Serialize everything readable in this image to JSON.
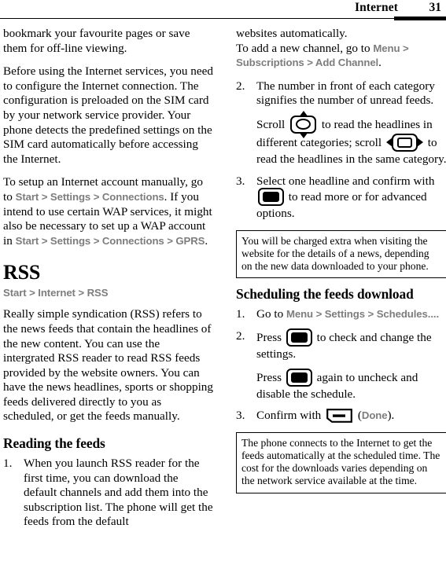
{
  "header": {
    "title": "Internet",
    "page_number": "31"
  },
  "left_column": {
    "para_bookmark": "bookmark your favourite pages or save them for off-line viewing.",
    "para_before_using": "Before using the Internet services, you need to configure the Internet connection. The configuration is preloaded on the SIM card by your network service provider. Your phone detects the predefined settings on the SIM card automatically before accessing the Internet.",
    "para_setup_pre": "To setup an Internet account manually, go to ",
    "path_start_1": "Start",
    "path_sep_1": " > ",
    "path_settings_1": "Settings",
    "path_sep_2": " > ",
    "path_connections_1": "Connections",
    "para_setup_mid": ". If you intend to use certain WAP services, it might also be necessary to set up a WAP account in ",
    "path_start_2": "Start",
    "path_sep_3": " > ",
    "path_settings_2": "Settings",
    "path_sep_4": " > ",
    "path_connections_2": "Connections",
    "path_sep_5": " > ",
    "path_gprs": "GPRS",
    "para_setup_end": ".",
    "heading_rss": "RSS",
    "rss_path_start": "Start",
    "rss_path_sep_1": " > ",
    "rss_path_internet": "Internet",
    "rss_path_sep_2": " > ",
    "rss_path_rss": "RSS",
    "para_rss_intro": "Really simple syndication (RSS) refers to the news feeds that contain the headlines of the new content. You can use the intergrated RSS reader to read RSS feeds provided by the website owners. You can have the news headlines, sports or shopping feeds delivered directly to you as scheduled, or get the feeds manually.",
    "heading_reading": "Reading the feeds",
    "step1_num": "1.",
    "step1_text": "When you launch RSS reader for the first time, you can download the default channels and add them into the subscription list. The phone will get the feeds from the default"
  },
  "right_column": {
    "cont_websites": "websites automatically.",
    "cont_addchannel_pre": "To add a new channel, go to ",
    "path_menu": "Menu",
    "path_sep_1": " > ",
    "path_subscriptions": "Subscriptions",
    "path_sep_2": " > ",
    "path_add_channel": "Add Channel",
    "cont_addchannel_end": ".",
    "step2_num": "2.",
    "step2_text": "The number in front of each category signifies the number of unread feeds.",
    "step2_scroll_pre": "Scroll ",
    "step2_scroll_mid": " to read the headlines in different categories; scroll ",
    "step2_scroll_end": " to read the headlines in the same category.",
    "step3_num": "3.",
    "step3_pre": "Select one headline and confirm with ",
    "step3_end": " to read more or for advanced options.",
    "note1": "You will be charged extra when visiting the website for the details of a news, depending on the new data downloaded to your phone.",
    "heading_scheduling": "Scheduling the feeds download",
    "sched1_num": "1.",
    "sched1_pre": "Go to ",
    "sched1_path_menu": "Menu",
    "sched1_sep_1": " > ",
    "sched1_path_settings": "Settings",
    "sched1_sep_2": " > ",
    "sched1_path_schedules": "Schedules....",
    "sched2_num": "2.",
    "sched2_pre": "Press ",
    "sched2_end": " to check and change the settings.",
    "sched2b_pre": "Press ",
    "sched2b_end": " again to uncheck and disable the schedule.",
    "sched3_num": "3.",
    "sched3_pre": "Confirm with ",
    "sched3_open": " (",
    "sched3_done": "Done",
    "sched3_close": ").",
    "note2": "The phone connects to the Internet to get the feeds automatically at the scheduled time. The cost for the downloads varies depending on the network service available at the time."
  },
  "icons": {
    "nav_updown": "nav-updown-key-icon",
    "nav_leftright": "nav-leftright-key-icon",
    "select_key": "select-ok-key-icon",
    "left_softkey": "left-softkey-icon"
  },
  "colors": {
    "uipath_gray": "#7d7d7d",
    "text_black": "#000000",
    "page_background": "#ffffff"
  }
}
